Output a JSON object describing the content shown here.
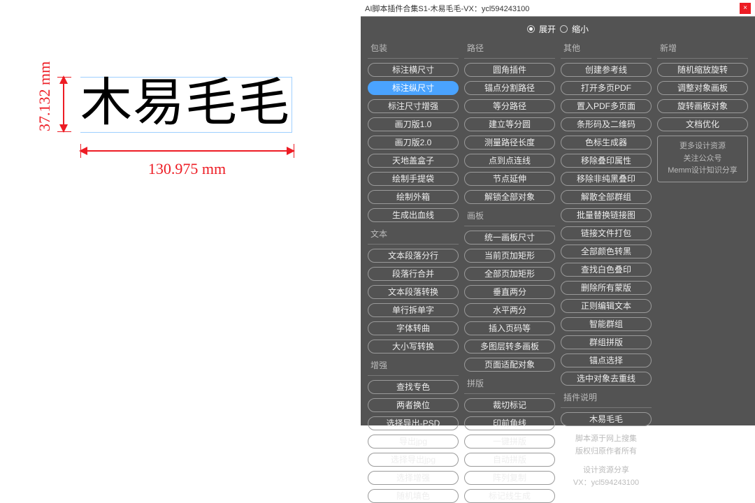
{
  "canvas": {
    "main_text": "木易毛毛",
    "v_dimension": "37.132 mm",
    "h_dimension": "130.975 mm"
  },
  "panel": {
    "title": "AI脚本插件合集S1-木易毛毛-VX：ycl594243100",
    "close": "×",
    "toggle": {
      "expand": "展开",
      "collapse": "缩小"
    },
    "groups": {
      "packaging": {
        "title": "包装",
        "items": [
          "标注横尺寸",
          "标注纵尺寸",
          "标注尺寸增强",
          "画刀版1.0",
          "画刀版2.0",
          "天地盖盒子",
          "绘制手提袋",
          "绘制外箱",
          "生成出血线"
        ]
      },
      "text": {
        "title": "文本",
        "items": [
          "文本段落分行",
          "段落行合并",
          "文本段落转换",
          "单行拆单字",
          "字体转曲",
          "大小写转换"
        ]
      },
      "enhance": {
        "title": "增强",
        "items": [
          "查找专色",
          "两者换位",
          "选择导出-PSD",
          "导出jpg",
          "选择导出jpg",
          "选择增强",
          "随机填色"
        ]
      },
      "path": {
        "title": "路径",
        "items": [
          "圆角插件",
          "锚点分割路径",
          "等分路径",
          "建立等分圆",
          "测量路径长度",
          "点到点连线",
          "节点延伸",
          "解锁全部对象"
        ]
      },
      "artboard": {
        "title": "画板",
        "items": [
          "统一画板尺寸",
          "当前页加矩形",
          "全部页加矩形",
          "垂直两分",
          "水平两分",
          "插入页码等",
          "多图层转多画板",
          "页面适配对象"
        ]
      },
      "layout": {
        "title": "拼版",
        "items": [
          "裁切标记",
          "印前角线",
          "一键拼版",
          "自动拼版",
          "阵列复制",
          "标记线生成"
        ]
      },
      "other": {
        "title": "其他",
        "items": [
          "创建参考线",
          "打开多页PDF",
          "置入PDF多页面",
          "条形码及二维码",
          "色标生成器",
          "移除叠印属性",
          "移除非纯黑叠印",
          "解散全部群组",
          "批量替换链接图",
          "链接文件打包",
          "全部颜色转黑",
          "查找白色叠印",
          "删除所有蒙版",
          "正则编辑文本",
          "智能群组",
          "群组拼版",
          "锚点选择",
          "选中对象去重线"
        ]
      },
      "new": {
        "title": "新增",
        "items": [
          "随机缩放旋转",
          "调整对象画板",
          "旋转画板对象",
          "文档优化"
        ]
      }
    },
    "about_title": "插件说明",
    "about_author": "木易毛毛",
    "resource_box": [
      "更多设计资源",
      "关注公众号",
      "Memm设计知识分享"
    ],
    "credits": [
      "脚本源于网上搜集",
      "版权归原作者所有"
    ],
    "footer": [
      "设计资源分享",
      "VX：ycl594243100"
    ]
  }
}
